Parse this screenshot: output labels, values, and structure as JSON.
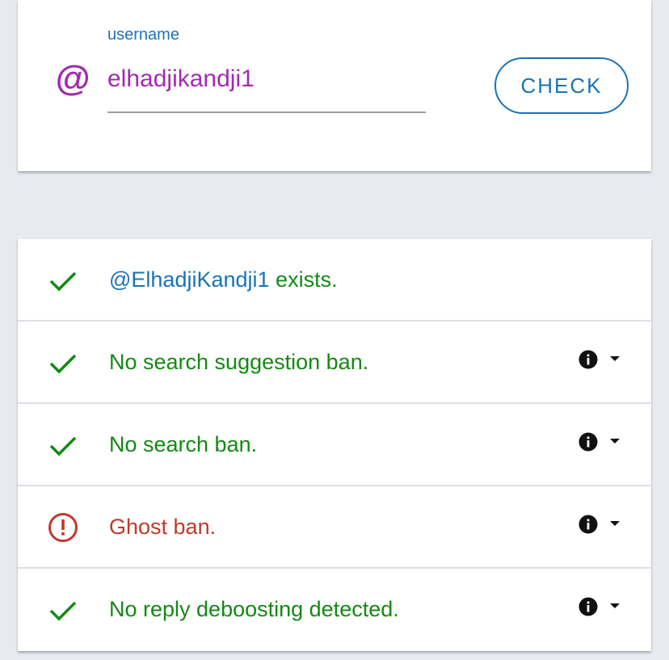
{
  "colors": {
    "accent_blue": "#1a73b8",
    "username_purple": "#a12bb0",
    "success_green": "#138a13",
    "error_red": "#c0392b",
    "dark_icon": "#111111"
  },
  "form": {
    "at_symbol": "@",
    "label": "username",
    "value": "elhadjikandji1",
    "check_label": "CHECK"
  },
  "results": [
    {
      "status": "ok",
      "icon": "check-icon",
      "handle": "@ElhadjiKandji1",
      "text": " exists.",
      "has_details": false
    },
    {
      "status": "ok",
      "icon": "check-icon",
      "text": "No search suggestion ban.",
      "has_details": true
    },
    {
      "status": "ok",
      "icon": "check-icon",
      "text": "No search ban.",
      "has_details": true
    },
    {
      "status": "ban",
      "icon": "alert-circle-icon",
      "text": "Ghost ban.",
      "has_details": true
    },
    {
      "status": "ok",
      "icon": "check-icon",
      "text": "No reply deboosting detected.",
      "has_details": true
    }
  ]
}
